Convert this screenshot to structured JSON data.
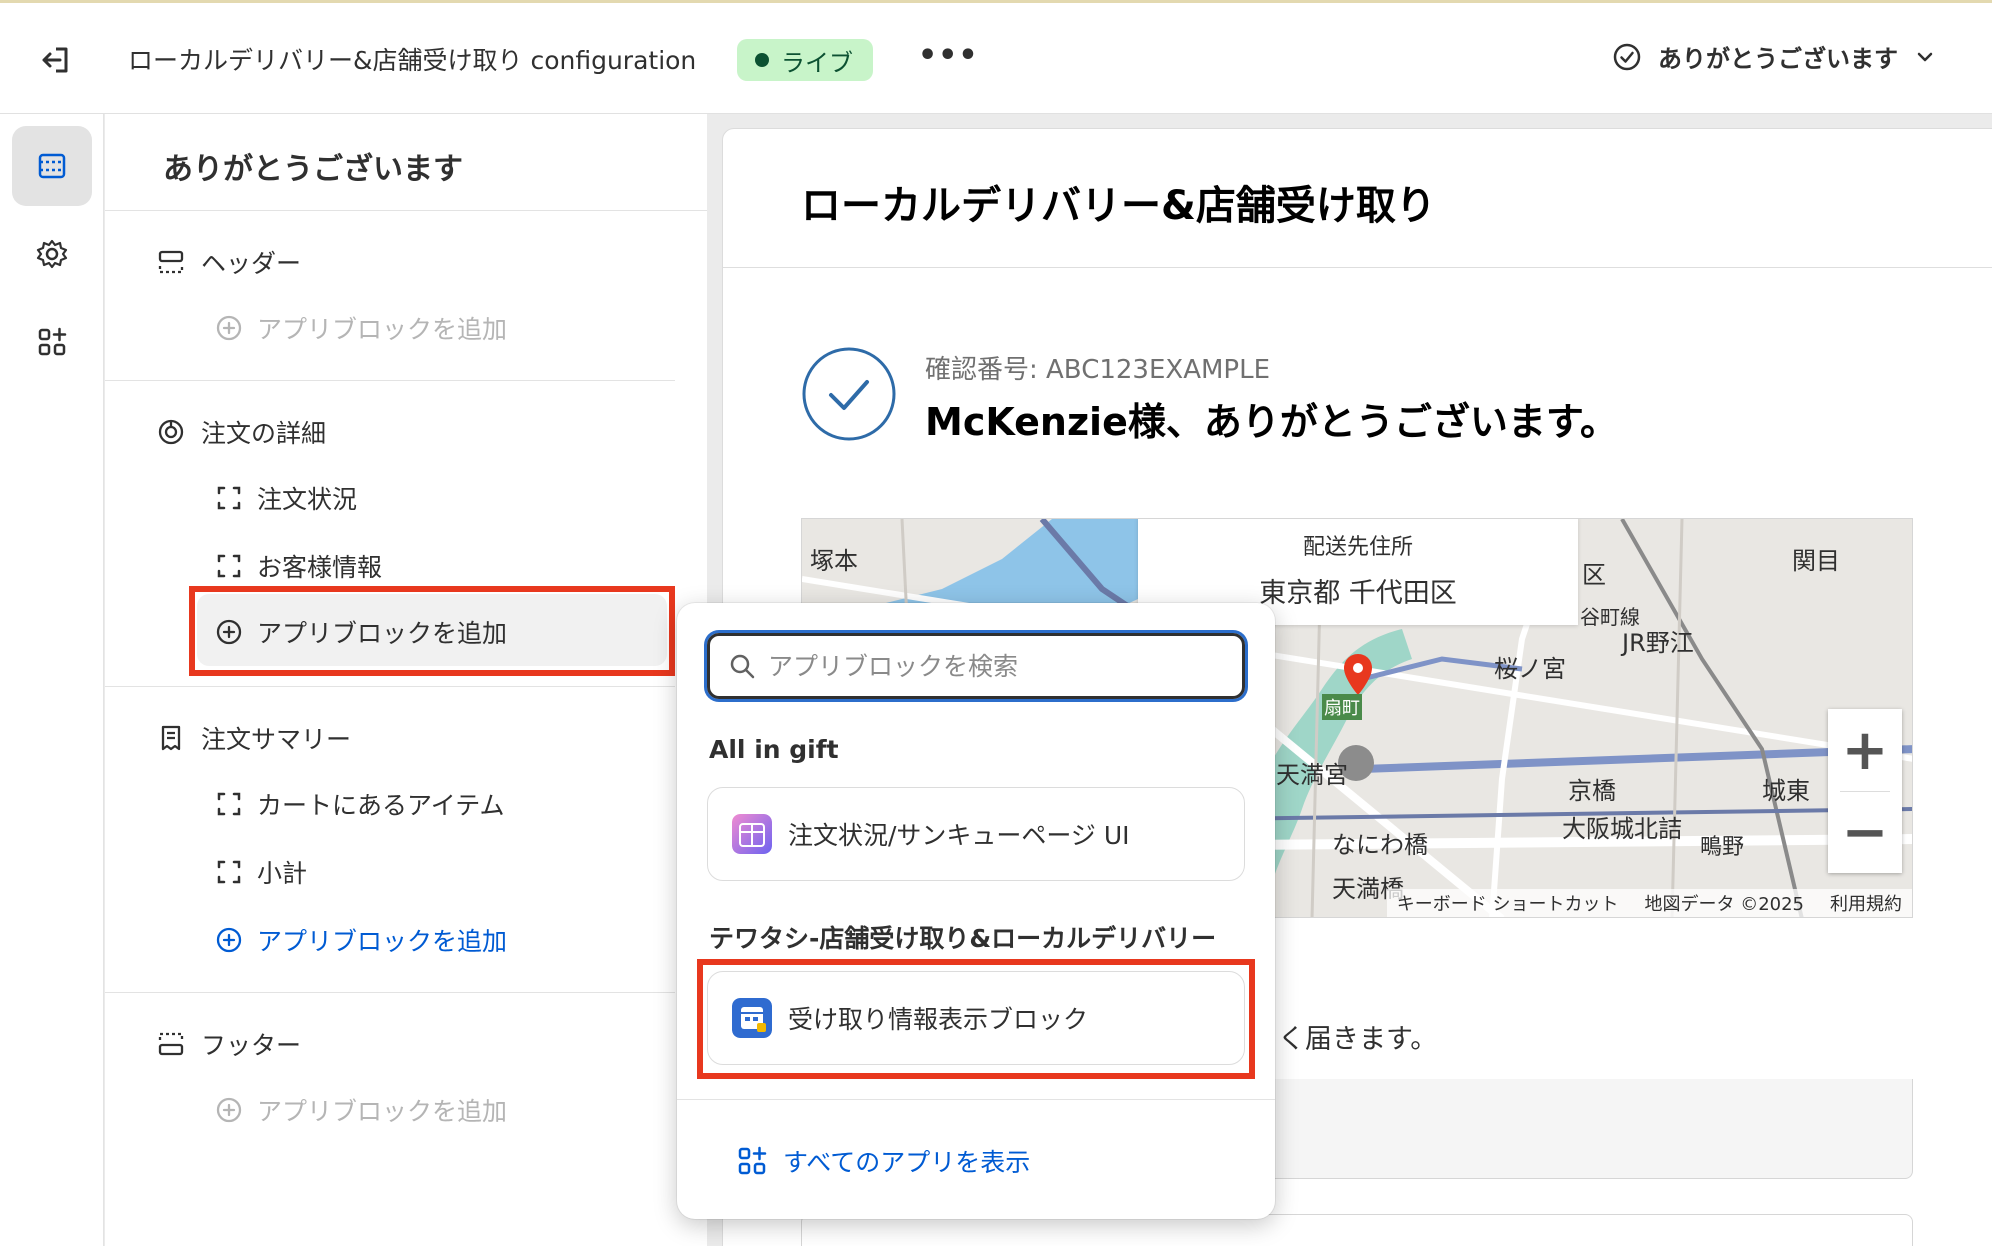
{
  "topbar": {
    "title": "ローカルデリバリー&店舗受け取り configuration",
    "status_badge": "ライブ",
    "more_label": "•••",
    "page_selector": "ありがとうございます"
  },
  "sidebar": {
    "heading": "ありがとうございます",
    "header_section": {
      "label": "ヘッダー",
      "add_label": "アプリブロックを追加"
    },
    "order_details_section": {
      "label": "注文の詳細",
      "items": [
        "注文状況",
        "お客様情報"
      ],
      "add_label": "アプリブロックを追加"
    },
    "order_summary_section": {
      "label": "注文サマリー",
      "items": [
        "カートにあるアイテム",
        "小計"
      ],
      "add_label": "アプリブロックを追加"
    },
    "footer_section": {
      "label": "フッター",
      "add_label": "アプリブロックを追加"
    }
  },
  "preview": {
    "title": "ローカルデリバリー&店舗受け取り",
    "confirmation": "確認番号: ABC123EXAMPLE",
    "thanks": "McKenzie様、ありがとうございます。",
    "map": {
      "address_label": "配送先住所",
      "address": "東京都 千代田区",
      "zoom_in": "+",
      "zoom_out": "−",
      "attribution": {
        "shortcuts": "キーボード ショートカット",
        "data": "地図データ ©2025",
        "terms": "利用規約"
      },
      "places": [
        "塚本",
        "関目",
        "JR野江",
        "桜ノ宮",
        "谷町線",
        "天満宮",
        "京橋",
        "大阪城北詰",
        "城東",
        "なにわ橋",
        "鴫野",
        "天満橋",
        "扇町",
        "区"
      ]
    },
    "delivery_text": "く届きます。"
  },
  "popup": {
    "search_placeholder": "アプリブロックを検索",
    "groups": [
      {
        "name": "All in gift",
        "items": [
          {
            "label": "注文状況/サンキューページ UI",
            "icon": "all-in-gift-icon"
          }
        ]
      },
      {
        "name": "テワタシ-店舗受け取り&ローカルデリバリー",
        "items": [
          {
            "label": "受け取り情報表示ブロック",
            "icon": "pickup-info-icon"
          }
        ]
      }
    ],
    "show_all": "すべてのアプリを表示"
  },
  "colors": {
    "accent_link": "#005bd3",
    "highlight_red": "#e8381e",
    "badge_bg": "#c8f4c9",
    "badge_text": "#0c5132"
  }
}
